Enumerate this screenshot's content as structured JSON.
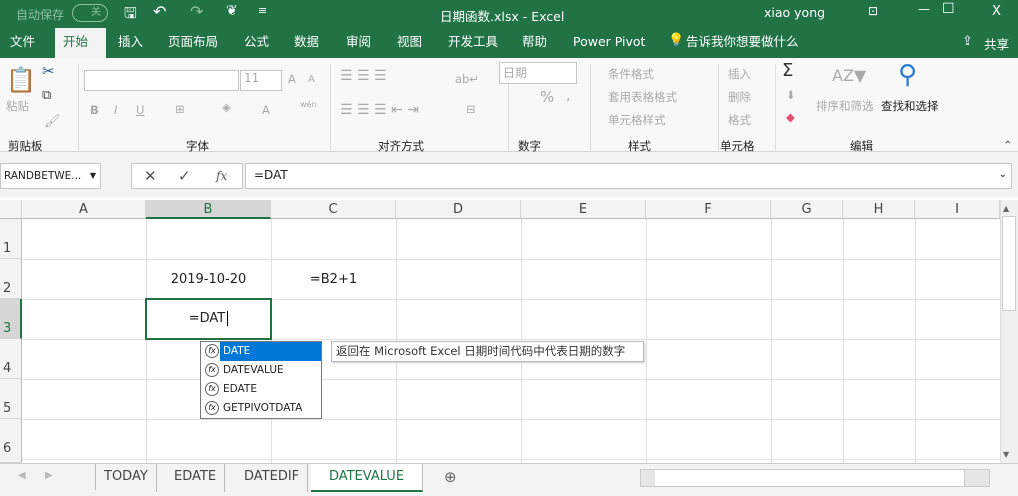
{
  "titlebar": {
    "autosave_label": "自动保存",
    "autosave_state": "关",
    "title": "日期函数.xlsx  -  Excel",
    "user": "xiao yong",
    "minimize": "—",
    "maximize": "☐",
    "close": "X"
  },
  "tabs": [
    {
      "label": "文件"
    },
    {
      "label": "开始"
    },
    {
      "label": "插入"
    },
    {
      "label": "页面布局"
    },
    {
      "label": "公式"
    },
    {
      "label": "数据"
    },
    {
      "label": "审阅"
    },
    {
      "label": "视图"
    },
    {
      "label": "开发工具"
    },
    {
      "label": "帮助"
    },
    {
      "label": "Power Pivot"
    },
    {
      "label": "告诉我你想要做什么"
    }
  ],
  "share": "共享",
  "ribbon": {
    "clipboard": {
      "paste": "粘贴",
      "group": "剪贴板"
    },
    "font": {
      "size": "11",
      "bold": "B",
      "italic": "I",
      "underline": "U",
      "grow": "A",
      "shrink": "A",
      "color": "A",
      "wen": "wén",
      "group": "字体"
    },
    "align": {
      "group": "对齐方式"
    },
    "number": {
      "format": "日期",
      "percent": "%",
      "comma": ",",
      "group": "数字"
    },
    "styles": {
      "cond": "条件格式",
      "table": "套用表格格式",
      "cell": "单元格样式",
      "group": "样式"
    },
    "cells": {
      "insert": "插入",
      "delete": "删除",
      "format": "格式",
      "group": "单元格"
    },
    "editing": {
      "sigma": "Σ",
      "sort": "排序和筛选",
      "find": "查找和选择",
      "group": "编辑"
    }
  },
  "formula_bar": {
    "name_box": "RANDBETWE...",
    "cancel": "✕",
    "enter": "✓",
    "fx": "fx",
    "value": "=DAT"
  },
  "columns": [
    "A",
    "B",
    "C",
    "D",
    "E",
    "F",
    "G",
    "H",
    "I"
  ],
  "rows": [
    "1",
    "2",
    "3",
    "4",
    "5",
    "6"
  ],
  "cells": {
    "B2": "2019-10-20",
    "C2": "=B2+1",
    "B3": "=DAT"
  },
  "autocomplete": {
    "items": [
      "DATE",
      "DATEVALUE",
      "EDATE",
      "GETPIVOTDATA"
    ],
    "selected": "DATE",
    "tooltip": "返回在 Microsoft Excel 日期时间代码中代表日期的数字"
  },
  "sheets": [
    "TODAY",
    "EDATE",
    "DATEDIF",
    "DATEVALUE"
  ],
  "active_sheet": "DATEVALUE",
  "colors": {
    "accent": "#217346",
    "selection": "#0078d7"
  }
}
